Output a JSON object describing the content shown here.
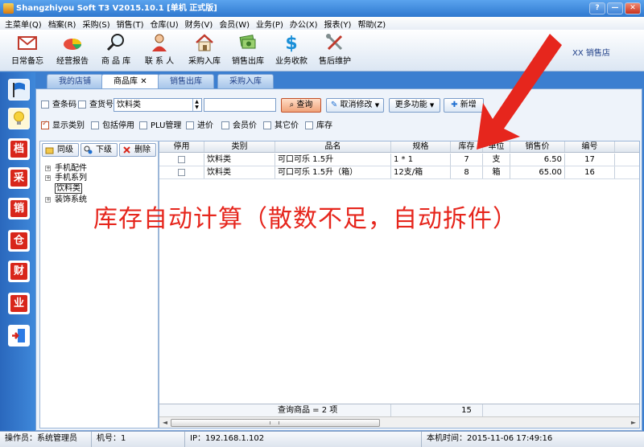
{
  "window": {
    "title": "Shangzhiyou Soft T3 V2015.10.1 [单机 正式版]",
    "buttons": [
      "?",
      "—",
      "✕"
    ]
  },
  "menu": [
    "主菜单(Q)",
    "档案(R)",
    "采购(S)",
    "销售(T)",
    "仓库(U)",
    "财务(V)",
    "会员(W)",
    "业务(P)",
    "办公(X)",
    "报表(Y)",
    "帮助(Z)"
  ],
  "toolbar": {
    "items": [
      {
        "label": "日常备忘",
        "icon": "mail-icon"
      },
      {
        "label": "经营报告",
        "icon": "pie-chart-icon"
      },
      {
        "label": "商 品 库",
        "icon": "magnifier-icon"
      },
      {
        "label": "联 系 人",
        "icon": "person-icon"
      },
      {
        "label": "采购入库",
        "icon": "house-icon"
      },
      {
        "label": "销售出库",
        "icon": "cash-icon"
      },
      {
        "label": "业务收款",
        "icon": "dollar-icon"
      },
      {
        "label": "售后维护",
        "icon": "tools-icon"
      }
    ],
    "shop_name": "XX  销售店"
  },
  "sidebar": {
    "items": [
      {
        "icon": "flag-icon"
      },
      {
        "icon": "bulb-icon"
      },
      {
        "icon": "archive-icon",
        "char": "档"
      },
      {
        "icon": "purchase-icon",
        "char": "采"
      },
      {
        "icon": "sales-icon",
        "char": "销"
      },
      {
        "icon": "warehouse-icon",
        "char": "仓"
      },
      {
        "icon": "finance-icon",
        "char": "财"
      },
      {
        "icon": "business-icon",
        "char": "业"
      },
      {
        "icon": "exit-icon"
      }
    ]
  },
  "tabs": [
    {
      "label": "我的店铺",
      "active": false
    },
    {
      "label": "商品库",
      "active": true,
      "close": "✕"
    },
    {
      "label": "销售出库",
      "active": false
    },
    {
      "label": "采购入库",
      "active": false
    }
  ],
  "search": {
    "barcode_label": "查条码",
    "item_no_label": "查货号",
    "category_value": "饮料类",
    "keyword_value": "",
    "query_label": "查询",
    "cancel_edit_label": "取消修改",
    "more_label": "更多功能",
    "add_label": "新增"
  },
  "options": [
    {
      "label": "显示类别",
      "checked": true
    },
    {
      "label": "包括停用",
      "checked": false
    },
    {
      "label": "PLU管理",
      "checked": false
    },
    {
      "label": "进价",
      "checked": false
    },
    {
      "label": "会员价",
      "checked": false
    },
    {
      "label": "其它价",
      "checked": false
    },
    {
      "label": "库存",
      "checked": false
    }
  ],
  "tree_actions": {
    "same_level": "同级",
    "sub_level": "下级",
    "delete": "删除"
  },
  "tree": [
    {
      "label": "手机配件",
      "toggle": "+"
    },
    {
      "label": "手机系列",
      "toggle": "+"
    },
    {
      "label": "饮料类",
      "selected": true
    },
    {
      "label": "装饰系统",
      "toggle": "+"
    }
  ],
  "table": {
    "columns": [
      "停用",
      "类别",
      "品名",
      "规格",
      "库存",
      "单位",
      "销售价",
      "编号"
    ],
    "rows": [
      {
        "disabled": false,
        "category": "饮料类",
        "name": "可口可乐 1.5升",
        "spec": "1 * 1",
        "stock": "7",
        "unit": "支",
        "price": "6.50",
        "code": "17"
      },
      {
        "disabled": false,
        "category": "饮料类",
        "name": "可口可乐 1.5升（箱）",
        "spec": "12支/箱",
        "stock": "8",
        "unit": "箱",
        "price": "65.00",
        "code": "16"
      }
    ],
    "footer_text": "查询商品 = 2 项",
    "footer_stock_total": "15"
  },
  "annotation": "库存自动计算（散数不足，自动拆件）",
  "status": {
    "operator": "操作员：系统管理员",
    "machine": "机号：1",
    "ip": "IP：192.168.1.102",
    "time": "本机时间：2015-11-06 17:49:16"
  },
  "colors": {
    "accent": "#3c7fd0",
    "annotation": "#e6261d",
    "highlight": "#c0502a"
  }
}
